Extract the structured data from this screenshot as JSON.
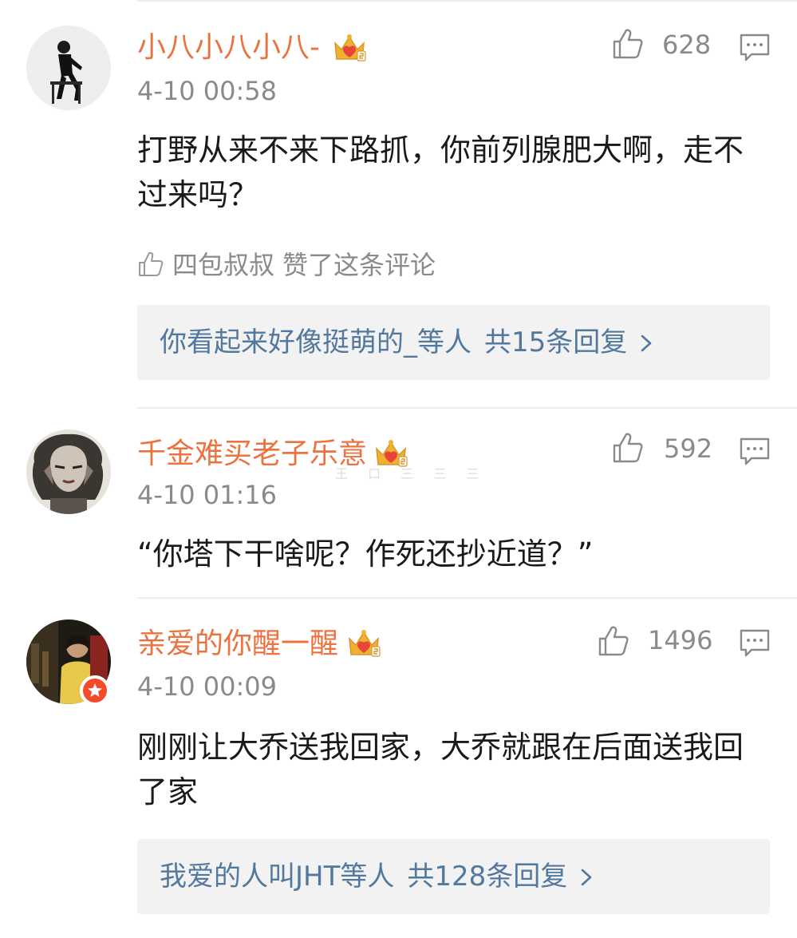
{
  "comments": [
    {
      "username": "小八小八小八-",
      "timestamp": "4-10 00:58",
      "like_count": "628",
      "content": "打野从来不来下路抓，你前列腺肥大啊，走不过来吗？",
      "liked_by": {
        "user": "四包叔叔",
        "text": "赞了这条评论"
      },
      "replies": {
        "users": "你看起来好像挺萌的_等人",
        "count_text": "共15条回复"
      },
      "icons": {
        "avatar": "avatar-woman-portrait",
        "vip": "crown-icon",
        "like": "thumbs-up-icon",
        "reply": "comment-icon"
      }
    },
    {
      "username": "千金难买老子乐意",
      "timestamp": "4-10 01:16",
      "like_count": "592",
      "content": "“你塔下干啥呢？作死还抄近道？”",
      "icons": {
        "avatar": "avatar-stylized-face",
        "vip": "crown-icon",
        "like": "thumbs-up-icon",
        "reply": "comment-icon"
      }
    },
    {
      "username": "亲爱的你醒一醒",
      "timestamp": "4-10 00:09",
      "like_count": "1496",
      "content": "刚刚让大乔送我回家，大乔就跟在后面送我回了家",
      "replies": {
        "users": "我爱的人叫JHT等人",
        "count_text": "共128条回复"
      },
      "icons": {
        "avatar": "avatar-person-dark",
        "vip": "crown-icon",
        "like": "thumbs-up-icon",
        "reply": "comment-icon",
        "badge": "verified-badge-icon"
      }
    }
  ],
  "watermark": "王 口 三 三 三",
  "colors": {
    "username": "#eb7340",
    "meta": "#8a8a8a",
    "body_text": "#1a1a1a",
    "reply_link": "#52789e",
    "reply_box_bg": "#f2f2f2",
    "divider": "#eeeeee",
    "vip_crown": "#f0b133",
    "vip_heart": "#e8443a",
    "verified_badge": "#f44a2c"
  }
}
